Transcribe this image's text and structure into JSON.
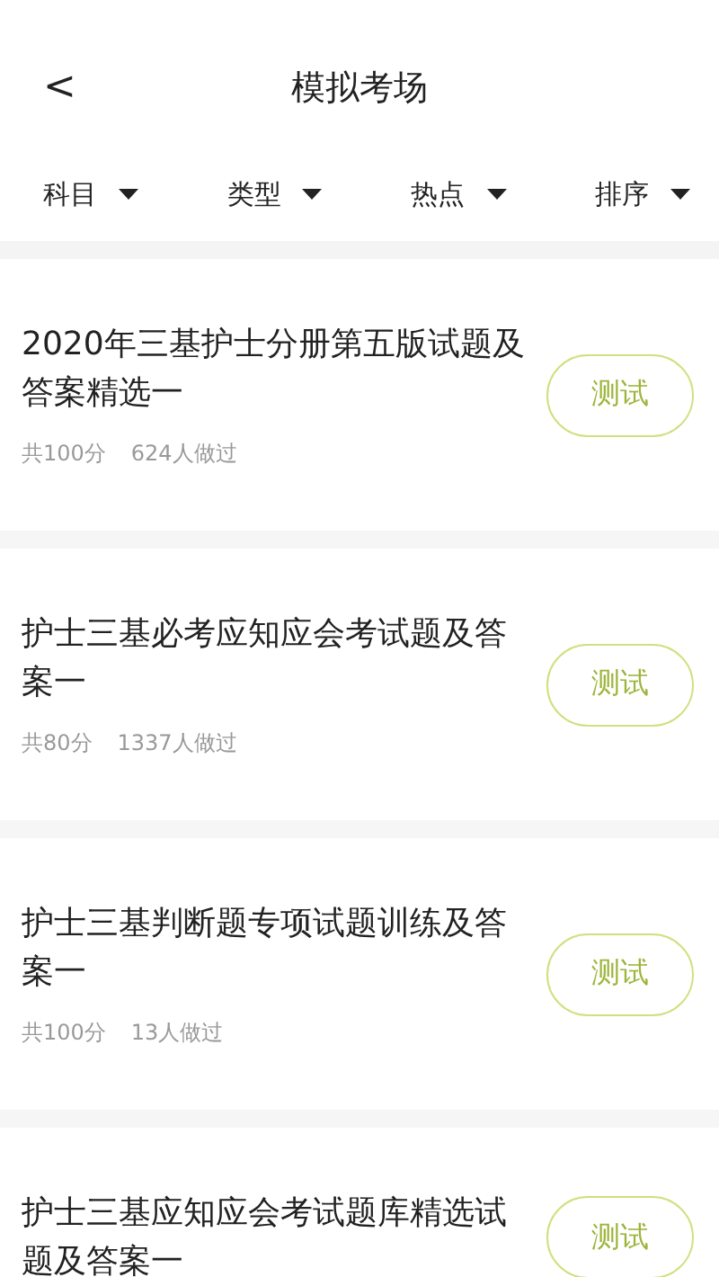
{
  "header": {
    "back": "<",
    "title": "模拟考场"
  },
  "filters": [
    {
      "label": "科目"
    },
    {
      "label": "类型"
    },
    {
      "label": "热点"
    },
    {
      "label": "排序"
    }
  ],
  "exams": [
    {
      "title": "2020年三基护士分册第五版试题及答案精选一",
      "score": "共100分",
      "taken": "624人做过",
      "button": "测试"
    },
    {
      "title": "护士三基必考应知应会考试题及答案一",
      "score": "共80分",
      "taken": "1337人做过",
      "button": "测试"
    },
    {
      "title": "护士三基判断题专项试题训练及答案一",
      "score": "共100分",
      "taken": "13人做过",
      "button": "测试"
    },
    {
      "title": "护士三基应知应会考试题库精选试题及答案一",
      "button": "测试"
    }
  ]
}
